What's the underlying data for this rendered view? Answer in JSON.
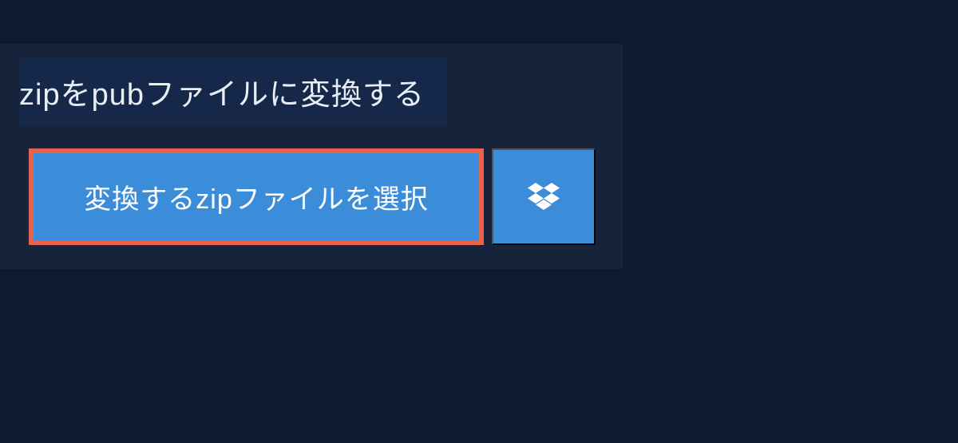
{
  "header": {
    "title": "zipをpubファイルに変換する"
  },
  "actions": {
    "select_file_label": "変換するzipファイルを選択"
  },
  "colors": {
    "background": "#0d1b2f",
    "panel": "#16233b",
    "title_bg": "#16284a",
    "button_bg": "#3b8dd9",
    "button_border": "#e8614c",
    "text_light": "#e8eef5"
  }
}
